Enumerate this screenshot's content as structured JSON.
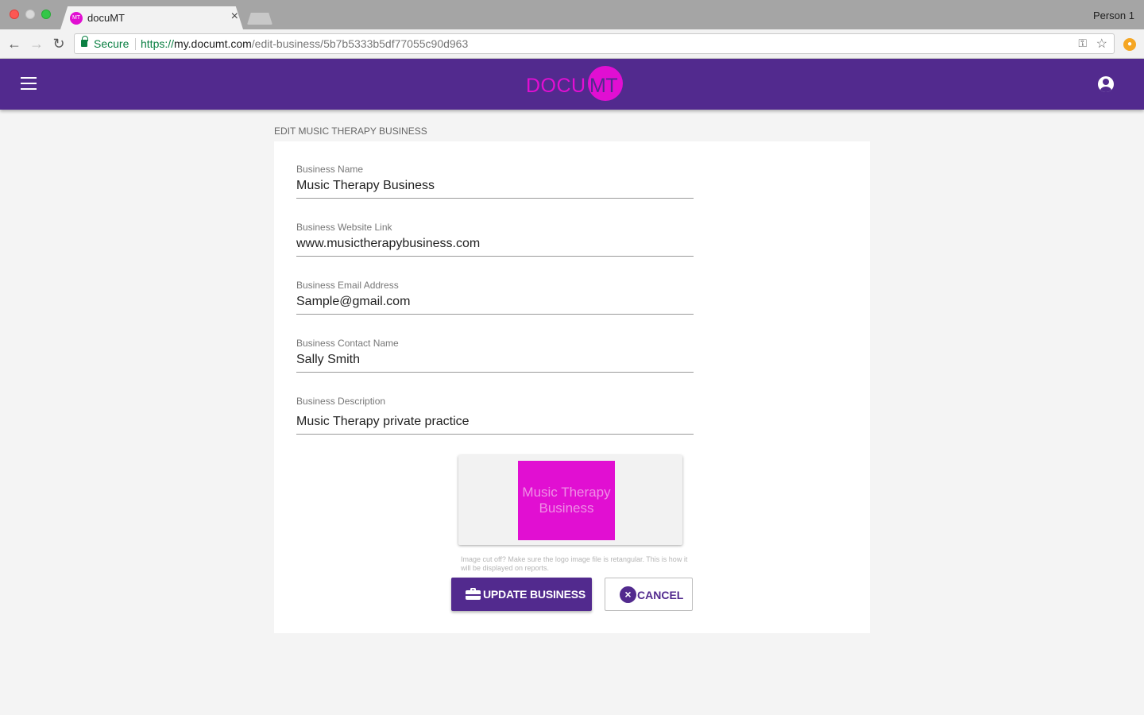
{
  "browser": {
    "tab_title": "docuMT",
    "tab_favicon_text": "MT",
    "profile_name": "Person 1",
    "secure_label": "Secure",
    "url_scheme": "https://",
    "url_host": "my.documt.com",
    "url_path": "/edit-business/5b7b5333b5df77055c90d963"
  },
  "header": {
    "logo_left": "DOCU",
    "logo_right": "MT"
  },
  "page": {
    "title": "EDIT MUSIC THERAPY BUSINESS"
  },
  "form": {
    "fields": [
      {
        "label": "Business Name",
        "value": "Music Therapy Business"
      },
      {
        "label": "Business Website Link",
        "value": "www.musictherapybusiness.com"
      },
      {
        "label": "Business Email Address",
        "value": "Sample@gmail.com"
      },
      {
        "label": "Business Contact Name",
        "value": "Sally Smith"
      },
      {
        "label": "Business Description",
        "value": "Music Therapy private practice"
      }
    ],
    "logo_text": "Music Therapy Business",
    "logo_hint": "Image cut off? Make sure the logo image file is retangular. This is how it will be displayed on reports.",
    "update_label": "UPDATE BUSINESS",
    "cancel_label": "CANCEL"
  },
  "colors": {
    "brand_purple": "#522a8e",
    "brand_magenta": "#e10fd2"
  },
  "icons": [
    "menu-icon",
    "account-circle-icon",
    "briefcase-icon",
    "close-circle-icon",
    "key-icon",
    "star-icon",
    "lock-icon"
  ]
}
